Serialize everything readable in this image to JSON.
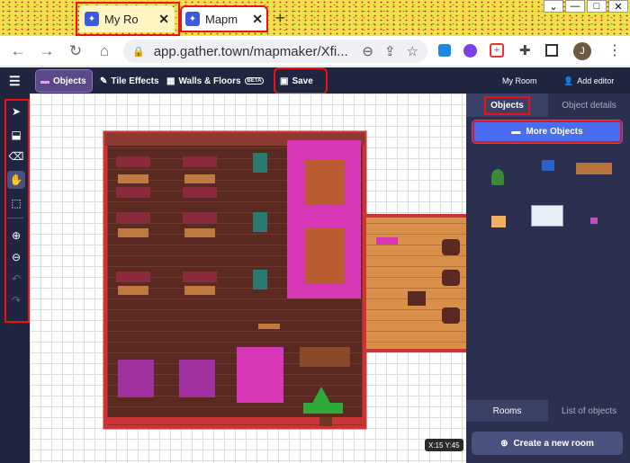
{
  "browser": {
    "tabs": [
      {
        "title": "My Ro"
      },
      {
        "title": "Mapm"
      }
    ],
    "new_tab": "+",
    "window_controls": [
      "⌄",
      "—",
      "□",
      "✕"
    ],
    "url": "app.gather.town/mapmaker/Xfi...",
    "profile_initial": "J"
  },
  "toolbar": {
    "objects": "Objects",
    "tile_effects": "Tile Effects",
    "walls_floors": "Walls & Floors",
    "beta": "BETA",
    "save": "Save",
    "my_room": "My Room",
    "add_editor": "Add editor"
  },
  "right_panel": {
    "tab_objects": "Objects",
    "tab_details": "Object details",
    "more_objects": "More Objects",
    "tab_rooms": "Rooms",
    "tab_list": "List of objects",
    "create_room": "Create a new room"
  },
  "coords": "X:15  Y:45",
  "colors": {
    "toolbar_bg": "#202540",
    "panel_bg": "#2b3050",
    "accent": "#4a6cf0",
    "highlight": "#e11111"
  }
}
